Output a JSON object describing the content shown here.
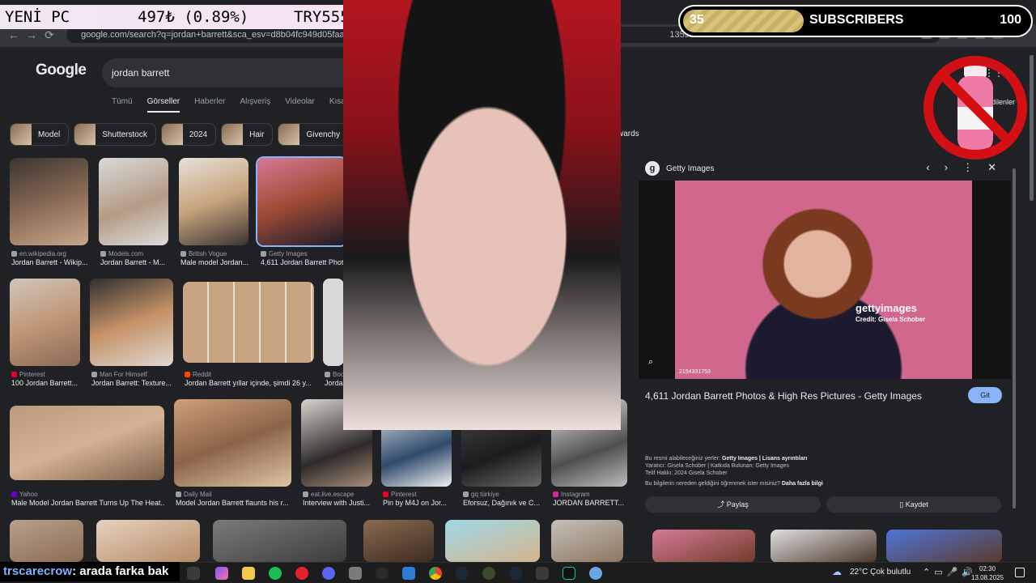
{
  "browser": {
    "url": "google.com/search?q=jordan+barrett&sca_esv=d8b04fc949d05faa&udm=2&",
    "url_tail": "1359237&ei=T86ba"
  },
  "google": {
    "logo": "Google",
    "query": "jordan barrett",
    "tabs": [
      "Tümü",
      "Görseller",
      "Haberler",
      "Alışveriş",
      "Videolar",
      "Kısa videolar"
    ],
    "chips": [
      "Model",
      "Shutterstock",
      "2024",
      "Hair",
      "Givenchy"
    ],
    "chip_right": "wards",
    "saved_label": "dedilenler"
  },
  "results": [
    {
      "source": "en.wikipedia.org",
      "title": "Jordan Barrett - Wikip..."
    },
    {
      "source": "Models.com",
      "title": "Jordan Barrett - M..."
    },
    {
      "source": "British Vogue",
      "title": "Male model Jordan..."
    },
    {
      "source": "Getty Images",
      "title": "4,611 Jordan Barrett Photo"
    },
    {
      "source": "Pinterest",
      "title": "100 Jordan Barrett..."
    },
    {
      "source": "Man For Himself",
      "title": "Jordan Barrett: Texture..."
    },
    {
      "source": "Reddit",
      "title": "Jordan Barrett yıllar içinde, şimdi 26 y..."
    },
    {
      "source": "Boo",
      "title": "Jorda"
    },
    {
      "source": "Yahoo",
      "title": "Male Model Jordan Barrett Turns Up The Heat..."
    },
    {
      "source": "Daily Mail",
      "title": "Model Jordan Barrett flaunts his r..."
    },
    {
      "source": "eat.live.escape",
      "title": "Interview with Justi..."
    },
    {
      "source": "Pinterest",
      "title": "Pin by M4J on Jor..."
    },
    {
      "source": "gq türkiye",
      "title": "Eforsuz, Dağınık ve C..."
    },
    {
      "source": "Instagram",
      "title": "JORDAN BARRETT..."
    }
  ],
  "panel": {
    "source": "Getty Images",
    "watermark": "gettyimages",
    "credit": "Credit: Gisela Schober",
    "image_id": "2154331753",
    "title": "4,611 Jordan Barrett Photos & High Res Pictures - Getty Images",
    "visit_button": "Git",
    "line1_prefix": "Bu resmi alabileceğiniz yerler:",
    "line1_bold": "Getty Images | Lisans ayrıntıları",
    "line2": "Yaratıcı: Gisela Schober | Katkıda Bulunan: Getty Images",
    "line3": "Telif Hakkı: 2024 Gisela Schober",
    "line4_prefix": "Bu bilgilerin nereden geldiğini öğrenmek ister misiniz?",
    "line4_bold": "Daha fazla bilgi",
    "share": "Paylaş",
    "save": "Kaydet"
  },
  "overlay": {
    "banner_left": "YENİ PC",
    "banner_mid": "497₺ (0.89%)",
    "banner_right": "TRY55555",
    "subs_current": "35",
    "subs_label": "SUBSCRIBERS",
    "subs_goal": "100",
    "subs_progress": 0.35,
    "chat_user": "trscarecrow",
    "chat_message": ": arada farka bak"
  },
  "taskbar": {
    "temperature": "22°C",
    "weather": "Çok bulutlu",
    "time": "02:30",
    "date": "13.08.2025"
  }
}
